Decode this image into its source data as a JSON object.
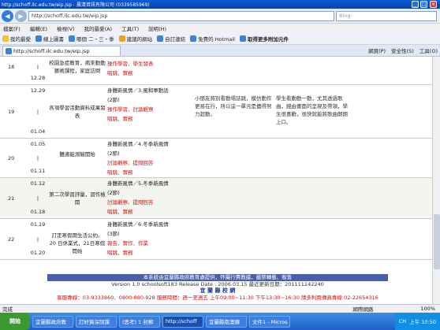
{
  "window": {
    "title": "http://schoff.ilc.edu.tw/eip.jsp - 晨清資訊有限公司 (0339585969)",
    "min": "_",
    "max": "□",
    "close": "×"
  },
  "address": {
    "url": "http://schoff.ilc.edu.tw/eip.jsp",
    "search_placeholder": "Bing"
  },
  "menu": [
    "檔案(F)",
    "編輯(E)",
    "檢視(V)",
    "我的最愛(A)",
    "工具(T)",
    "說明(H)"
  ],
  "favorites": {
    "label": "我的最愛",
    "items": [
      "線上圖書",
      "哪個 二・三・季",
      "建議的網站",
      "自訂連結",
      "免費的 Hotmail",
      "取得更多附加元件"
    ]
  },
  "tab": {
    "title": "http://schoff.ilc.edu.tw/eip.jsp"
  },
  "commands": [
    "網頁(P)",
    "安全性(S)",
    "工具(O)"
  ],
  "plan": [
    {
      "no": "18",
      "date_from": "12.22",
      "date_to": "12.28",
      "topic": "校園急症教育，病來動動 藝術課程，家庭訪問",
      "methods": [
        {
          "text": "(2節)",
          "red": false
        },
        {
          "text": "操作學習、學生發表",
          "red": true
        },
        {
          "text": "唱跳、實務",
          "red": true
        }
      ],
      "ability": "",
      "effect": ""
    },
    {
      "no": "19",
      "date_from": "12.29",
      "date_to": "01.04",
      "topic": "各項學習活動資料成果發表",
      "methods": [
        {
          "text": "身體新風情／3.風和軍動話",
          "red": false
        },
        {
          "text": "(2節)",
          "red": false
        },
        {
          "text": "操作學習、討論觀察",
          "red": true
        },
        {
          "text": "唱跳、實務",
          "red": true
        }
      ],
      "ability": "小朋友將別看動場誌跳，模仿動作更易在行，所以這一單元是儘得努力超動。",
      "effect": "學生看動動一動，尤其透過歌曲，經由畫面的呈現及帶領，學生很喜歡，很快就能將歌曲朗朗上口。"
    },
    {
      "no": "20",
      "date_from": "01.05",
      "date_to": "01.11",
      "topic": "體適能測驗開始",
      "methods": [
        {
          "text": "身體新風情／4.冬季新風情",
          "red": false
        },
        {
          "text": "(2節)",
          "red": false
        },
        {
          "text": "討論觀察、提問回答",
          "red": true
        },
        {
          "text": "唱跳、實務",
          "red": true
        }
      ],
      "ability": "",
      "effect": ""
    },
    {
      "no": "21",
      "date_from": "01.12",
      "date_to": "01.18",
      "topic": "第二次學習評量，習作檢閱",
      "methods": [
        {
          "text": "身體新風情／5.冬季新風情",
          "red": false
        },
        {
          "text": "(2節)",
          "red": false
        },
        {
          "text": "討論觀察、提問回答",
          "red": true
        },
        {
          "text": "唱跳、實務",
          "red": true
        }
      ],
      "ability": "",
      "effect": ""
    },
    {
      "no": "22",
      "date_from": "01.19",
      "date_to": "01.20",
      "topic": "訂定寒假期生活公約。20 日休業式，21日寒假開始",
      "methods": [
        {
          "text": "身體新風情／6.冬季新風情",
          "red": false
        },
        {
          "text": "(3節)",
          "red": false
        },
        {
          "text": "報告、實作、作業",
          "red": true
        },
        {
          "text": "唱跳、實務",
          "red": true
        }
      ],
      "ability": "",
      "effect": ""
    }
  ],
  "footer": {
    "line1": "本系統由宜蘭縣政府教育處提供，怀屬行費教據，嚴禁轉載、販售",
    "line2": "Version 1.0 schoolsoft183  Release Date : 2006.03.15  最近更新日期：201111242240",
    "line3": "宜 蘭 縣 校 網",
    "line4": "客服專線：03-9333860、0800-880-928 服務時間：週一至週五 上午09:00~11:30 下午13:30~16:30 請多利用傳真專線:02-22654316"
  },
  "status": {
    "left": "完成",
    "zone": "網際網路",
    "zoom": "100%"
  },
  "taskbar": {
    "start": "開始",
    "items": [
      "宜蘭縣政府教",
      "訂好資深詞課",
      "(思考) 1 封郵",
      "http://schoff",
      "宜蘭縣南澳鄉",
      "文件1 - Micros"
    ],
    "lang": "CH",
    "clock": "上午 10:50"
  }
}
